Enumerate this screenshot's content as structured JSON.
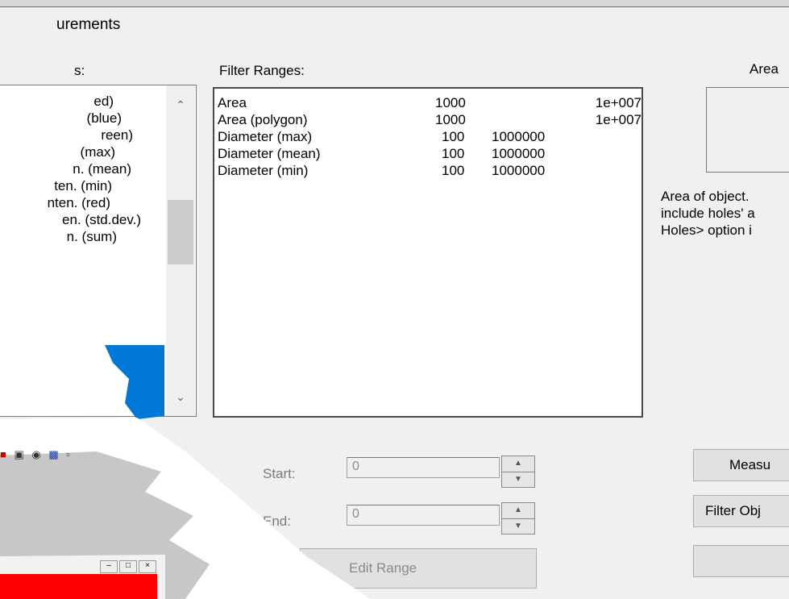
{
  "dialog": {
    "title": "urements",
    "measurements_header": "s:",
    "filter_header": "Filter Ranges:",
    "area_header": "Area"
  },
  "measure_list": [
    "ed)",
    "(blue)",
    "reen)",
    "(max)",
    "n. (mean)",
    "ten. (min)",
    "nten. (red)",
    "en. (std.dev.)",
    "n. (sum)"
  ],
  "filter_ranges": [
    {
      "name": "Area",
      "min": "1000",
      "max": "1e+007"
    },
    {
      "name": "Area (polygon)",
      "min": "1000",
      "max": "1e+007"
    },
    {
      "name": "Diameter (max)",
      "min": "100",
      "max": "1000000"
    },
    {
      "name": "Diameter (mean)",
      "min": "100",
      "max": "1000000"
    },
    {
      "name": "Diameter (min)",
      "min": "100",
      "max": "1000000"
    }
  ],
  "description": {
    "line1": "Area of object.",
    "line2": "include holes' a",
    "line3": "Holes> option i"
  },
  "range_controls": {
    "start_label": "Start:",
    "start_value": "0",
    "end_label": "End:",
    "end_value": "0",
    "edit_range_label": "Edit Range"
  },
  "right_buttons": {
    "measure_label": "Measu",
    "filter_label": "Filter Obj"
  },
  "colors": {
    "accent_blue": "#0078d7",
    "red_panel": "#ff0000",
    "dialog_bg": "#f0f0f0"
  }
}
